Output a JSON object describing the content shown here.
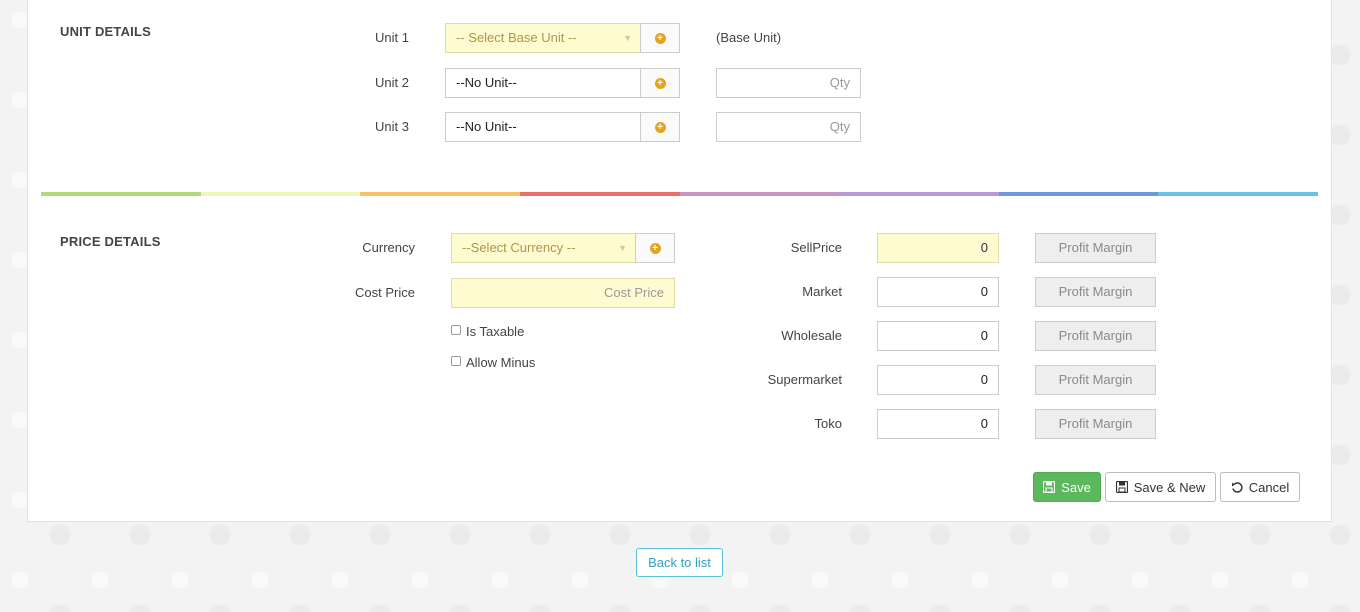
{
  "unit_details": {
    "title": "UNIT DETAILS",
    "unit1": {
      "label": "Unit 1",
      "placeholder": "-- Select Base Unit --",
      "note": "(Base Unit)"
    },
    "unit2": {
      "label": "Unit 2",
      "value": "--No Unit--",
      "qty_placeholder": "Qty"
    },
    "unit3": {
      "label": "Unit 3",
      "value": "--No Unit--",
      "qty_placeholder": "Qty"
    }
  },
  "price_details": {
    "title": "PRICE DETAILS",
    "currency": {
      "label": "Currency",
      "placeholder": "--Select Currency --"
    },
    "cost_price": {
      "label": "Cost Price",
      "placeholder": "Cost Price"
    },
    "is_taxable": {
      "label": "Is Taxable",
      "checked": false
    },
    "allow_minus": {
      "label": "Allow Minus",
      "checked": false
    },
    "prices": [
      {
        "label": "SellPrice",
        "value": "0",
        "margin_placeholder": "Profit Margin"
      },
      {
        "label": "Market",
        "value": "0",
        "margin_placeholder": "Profit Margin"
      },
      {
        "label": "Wholesale",
        "value": "0",
        "margin_placeholder": "Profit Margin"
      },
      {
        "label": "Supermarket",
        "value": "0",
        "margin_placeholder": "Profit Margin"
      },
      {
        "label": "Toko",
        "value": "0",
        "margin_placeholder": "Profit Margin"
      }
    ]
  },
  "actions": {
    "save": "Save",
    "save_new": "Save & New",
    "cancel": "Cancel",
    "back": "Back to list"
  },
  "colors": {
    "rainbow": [
      "#b3d97a",
      "#eef6b8",
      "#f7c36a",
      "#e8716a",
      "#c995c6",
      "#b89ad8",
      "#6f9ad9",
      "#66c3e3"
    ],
    "save_button": "#5cb85c",
    "back_button": "#5bc0de"
  },
  "icons": {
    "add": "plus-circle-icon",
    "save": "floppy-disk-icon",
    "cancel": "undo-icon"
  }
}
